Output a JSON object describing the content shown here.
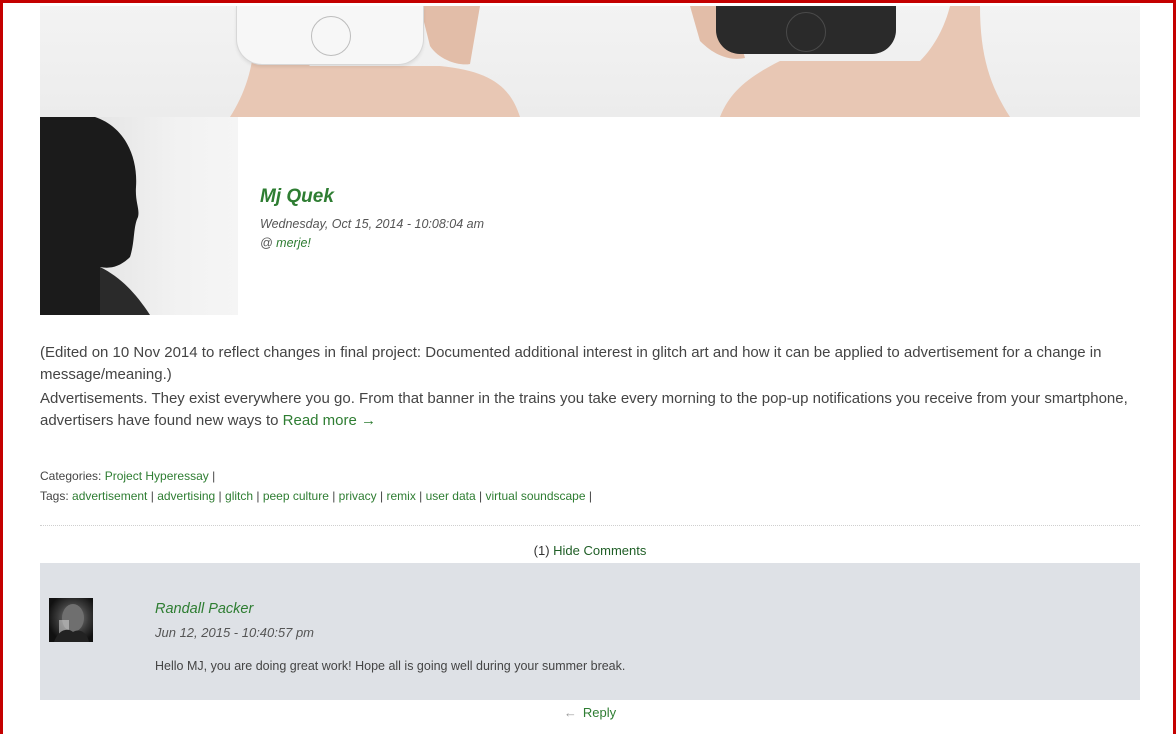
{
  "author": {
    "name": "Mj Quek",
    "date": "Wednesday, Oct 15, 2014 - 10:08:04 am",
    "site_prefix": "@ ",
    "site": "merje!"
  },
  "excerpt": {
    "edit_note": "(Edited on 10 Nov 2014 to reflect changes in final project: Documented additional interest in glitch art and how it can be applied to advertisement for a change in message/meaning.)",
    "body": "Advertisements. They exist everywhere you go. From that banner in the trains you take every morning to the pop-up notifications you receive from your smartphone, advertisers have found new ways to ",
    "read_more": "Read more →"
  },
  "categories": {
    "label": "Categories: ",
    "items": [
      "Project Hyperessay"
    ],
    "separator": " |"
  },
  "tags": {
    "label": "Tags: ",
    "items": [
      "advertisement",
      "advertising",
      "glitch",
      "peep culture",
      "privacy",
      "remix",
      "user data",
      "virtual soundscape"
    ],
    "separator": " |"
  },
  "comments": {
    "count": "(1)",
    "toggle_label": "Hide Comments",
    "items": [
      {
        "author": "Randall Packer",
        "date": "Jun 12, 2015 - 10:40:57 pm",
        "text": "Hello MJ, you are doing great work! Hope all is going well during your summer break."
      }
    ],
    "reply_icon": "←",
    "reply_label": "Reply"
  },
  "colors": {
    "accent": "#2e7d32",
    "frame": "#c40000",
    "comment_bg": "#dee1e6"
  }
}
